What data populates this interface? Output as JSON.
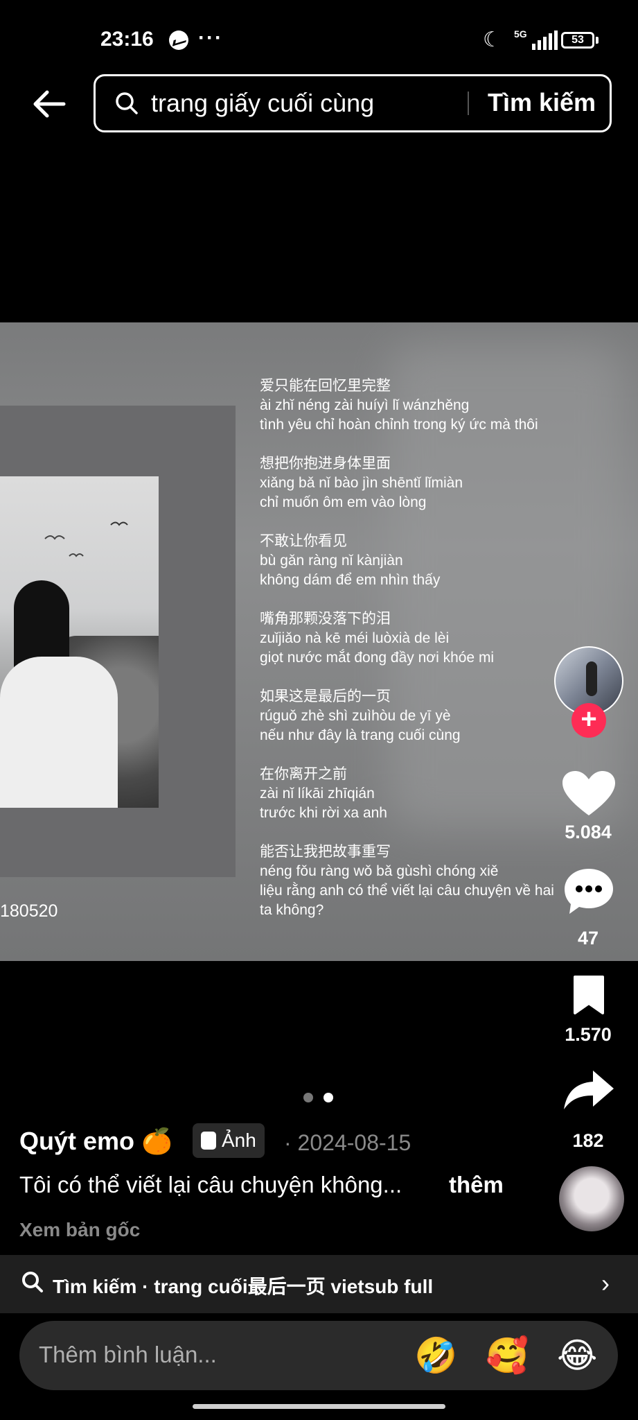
{
  "status_bar": {
    "time": "23:16",
    "more": "···",
    "moon_icon": "☾",
    "network": "5G",
    "battery": "53"
  },
  "search": {
    "query": "trang giấy cuối cùng",
    "button_label": "Tìm kiếm"
  },
  "post": {
    "photo_code": "180520",
    "lyrics": [
      {
        "zh": "爱只能在回忆里完整",
        "pinyin": "ài zhǐ néng zài huíyì lǐ wánzhěng",
        "vi": "tình yêu chỉ hoàn chỉnh trong ký ức mà thôi"
      },
      {
        "zh": "想把你抱进身体里面",
        "pinyin": "xiǎng bǎ nǐ bào jìn shēntǐ lǐmiàn",
        "vi": "chỉ muốn ôm em vào lòng"
      },
      {
        "zh": "不敢让你看见",
        "pinyin": "bù gǎn ràng nǐ kànjiàn",
        "vi": "không dám để em nhìn thấy"
      },
      {
        "zh": "嘴角那颗没落下的泪",
        "pinyin": "zuǐjiǎo nà kē méi luòxià de lèi",
        "vi": "giọt nước mắt đong đầy nơi khóe mi"
      },
      {
        "zh": "如果这是最后的一页",
        "pinyin": "rúguǒ zhè shì zuìhòu de yī yè",
        "vi": "nếu như đây là trang cuối cùng"
      },
      {
        "zh": "在你离开之前",
        "pinyin": "zài nǐ líkāi zhīqián",
        "vi": "trước khi rời xa anh"
      },
      {
        "zh": "能否让我把故事重写",
        "pinyin": "néng fǒu ràng wǒ bǎ gùshì chóng xiě",
        "vi": "liệu rằng anh có thể viết lại câu chuyện về hai ta không?"
      }
    ],
    "author": "Quýt emo 🍊",
    "tag_label": "Ảnh",
    "date": "· 2024-08-15",
    "caption": "Tôi có thể viết lại câu chuyện không...",
    "more_label": "thêm",
    "view_original": "Xem bản gốc"
  },
  "actions": {
    "follow": "+",
    "likes": "5.084",
    "comments": "47",
    "saves": "1.570",
    "shares": "182"
  },
  "related_search": {
    "label": "Tìm kiếm · trang cuối最后一页 vietsub full",
    "chevron": "›"
  },
  "comment_input": {
    "placeholder": "Thêm bình luận...",
    "emojis": [
      "🤣",
      "🥰",
      "😂"
    ]
  },
  "carousel": {
    "pages": 2,
    "active": 2
  },
  "colors": {
    "accent": "#fe2c55",
    "muted": "#8a8a8a"
  }
}
